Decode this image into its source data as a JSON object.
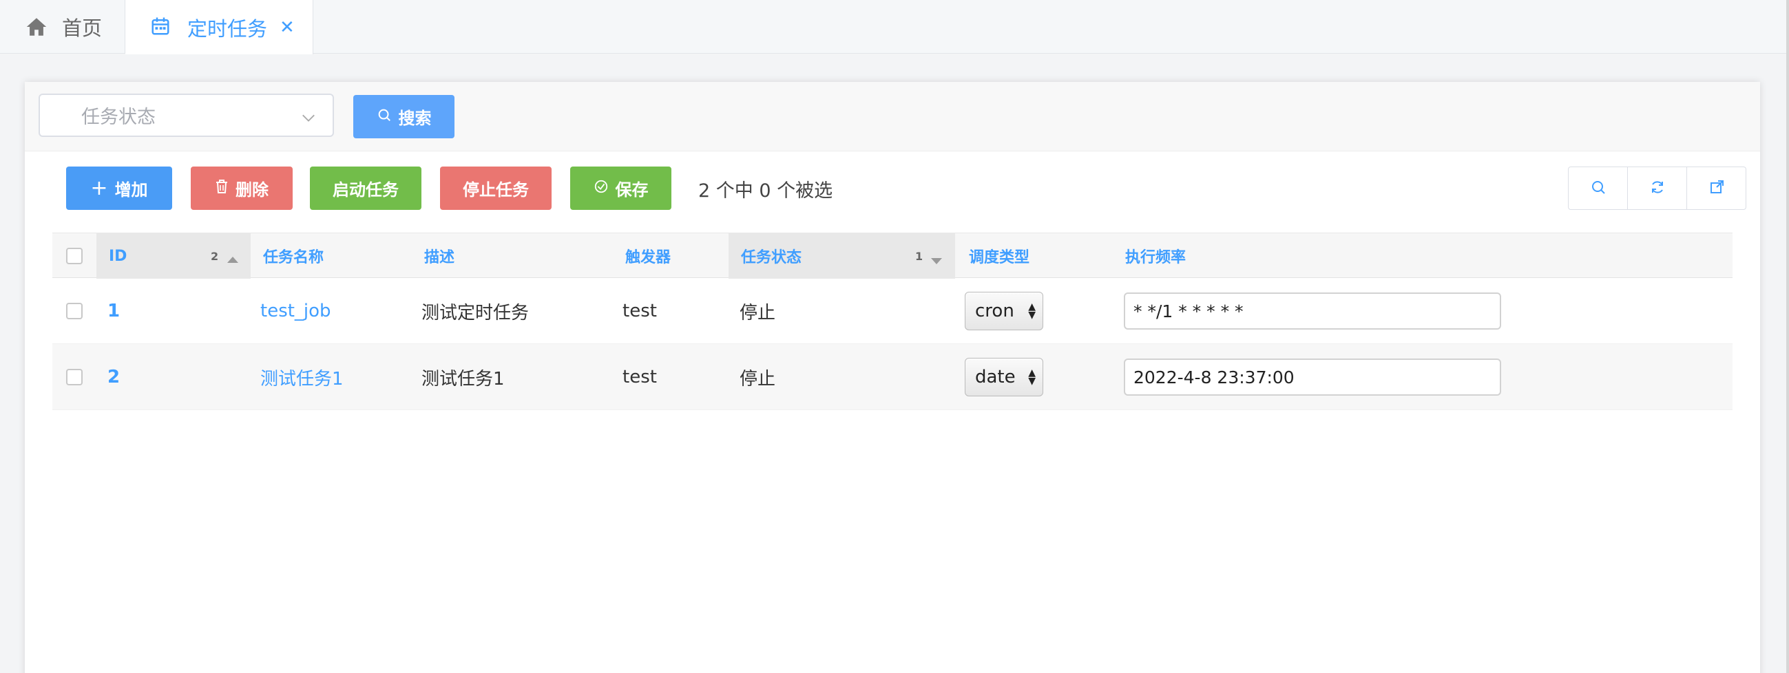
{
  "tabs": {
    "home_label": "首页",
    "active_label": "定时任务"
  },
  "filter": {
    "status_placeholder": "任务状态",
    "search_label": "搜索"
  },
  "toolbar": {
    "add_label": "增加",
    "delete_label": "删除",
    "start_label": "启动任务",
    "stop_label": "停止任务",
    "save_label": "保存",
    "selection_info": "2 个中 0 个被选"
  },
  "table": {
    "columns": {
      "id": "ID",
      "id_sort_order": "2",
      "name": "任务名称",
      "desc": "描述",
      "trigger": "触发器",
      "status": "任务状态",
      "status_sort_order": "1",
      "schedule_type": "调度类型",
      "frequency": "执行频率"
    },
    "rows": [
      {
        "id": "1",
        "name": "test_job",
        "desc": "测试定时任务",
        "trigger": "test",
        "status": "停止",
        "schedule_type": "cron",
        "frequency": "* */1 * * * * *"
      },
      {
        "id": "2",
        "name": "测试任务1",
        "desc": "测试任务1",
        "trigger": "test",
        "status": "停止",
        "schedule_type": "date",
        "frequency": "2022-4-8 23:37:00"
      }
    ]
  },
  "colors": {
    "primary": "#409eff",
    "danger": "#ea7671",
    "success": "#72bd4a"
  }
}
